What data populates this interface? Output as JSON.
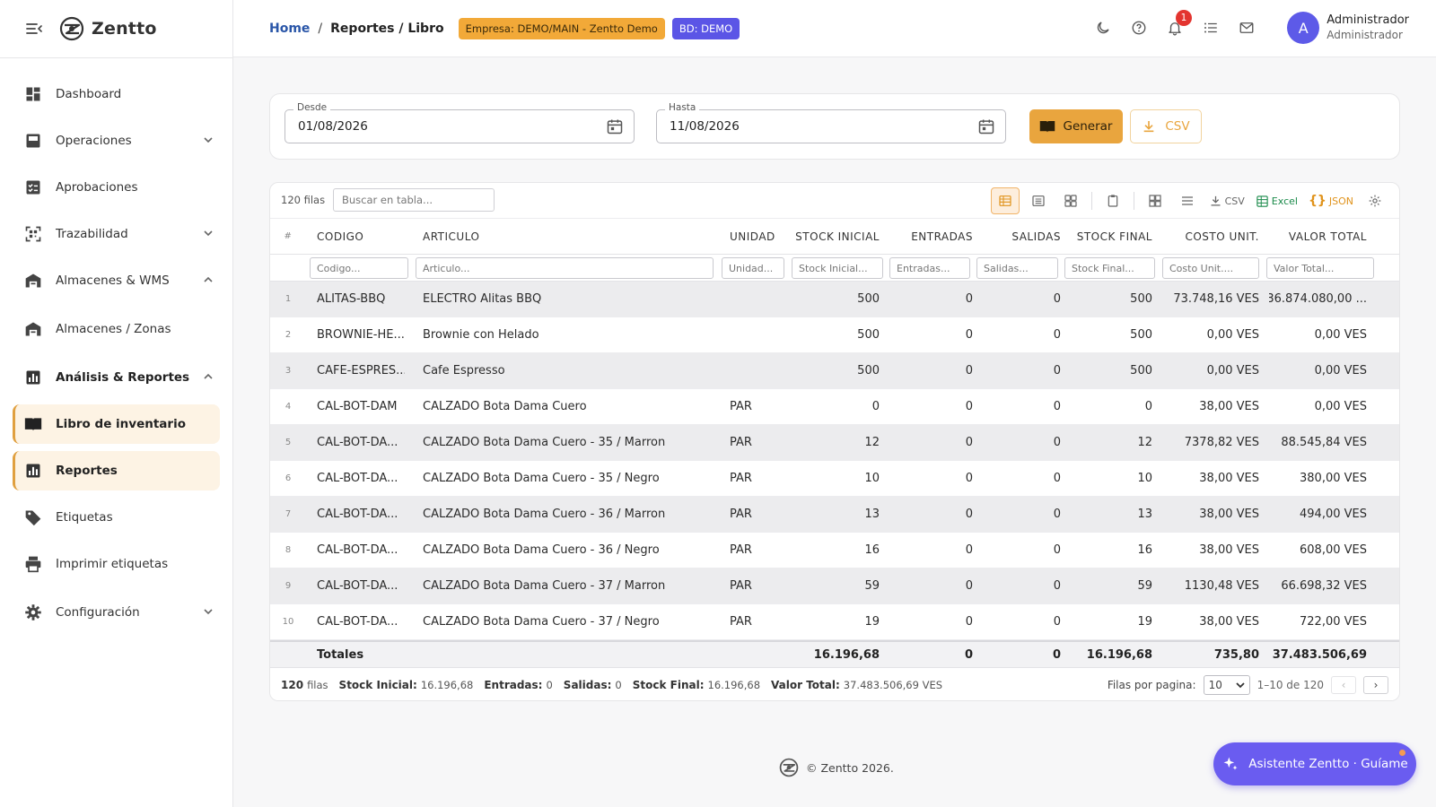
{
  "colors": {
    "accent": "#e9a53e",
    "brand_purple": "#5d5ae8",
    "link_blue": "#2a56a8",
    "badge_red": "#e3342f"
  },
  "brand": {
    "name": "Zentto"
  },
  "sidebar": {
    "items": [
      {
        "label": "Dashboard",
        "icon": "dashboard-icon"
      },
      {
        "label": "Operaciones",
        "icon": "inbox-icon",
        "chevron": "down"
      },
      {
        "label": "Aprobaciones",
        "icon": "checklist-icon"
      },
      {
        "label": "Trazabilidad",
        "icon": "qr-scan-icon",
        "chevron": "down"
      },
      {
        "label": "Almacenes & WMS",
        "icon": "warehouse-icon",
        "chevron": "up"
      },
      {
        "label": "Almacenes / Zonas",
        "icon": "warehouse-icon"
      },
      {
        "label": "Análisis & Reportes",
        "icon": "bar-chart-icon",
        "chevron": "up"
      },
      {
        "label": "Libro de inventario",
        "icon": "book-icon",
        "active": true
      },
      {
        "label": "Reportes",
        "icon": "bar-chart-icon",
        "active": true
      },
      {
        "label": "Etiquetas",
        "icon": "tag-icon"
      },
      {
        "label": "Imprimir etiquetas",
        "icon": "printer-icon"
      },
      {
        "label": "Configuración",
        "icon": "gear-icon",
        "chevron": "down"
      }
    ]
  },
  "header": {
    "breadcrumb": {
      "home": "Home",
      "separator": "/",
      "current": "Reportes / Libro"
    },
    "empresa_chip": "Empresa: DEMO/MAIN - Zentto Demo",
    "bd_chip": "BD: DEMO",
    "notifications_count": "1",
    "user": {
      "initial": "A",
      "name": "Administrador",
      "role": "Administrador"
    }
  },
  "filters": {
    "desde": {
      "label": "Desde",
      "value": "01/08/2026"
    },
    "hasta": {
      "label": "Hasta",
      "value": "11/08/2026"
    },
    "generar_label": "Generar",
    "csv_label": "CSV"
  },
  "grid": {
    "rows_count_label": "120 filas",
    "search_placeholder": "Buscar en tabla...",
    "toolbar": {
      "csv": "CSV",
      "excel": "Excel",
      "json": "JSON"
    },
    "columns": [
      "#",
      "CODIGO",
      "ARTICULO",
      "UNIDAD",
      "STOCK INICIAL",
      "ENTRADAS",
      "SALIDAS",
      "STOCK FINAL",
      "COSTO UNIT.",
      "VALOR TOTAL"
    ],
    "filter_placeholders": [
      "Codigo...",
      "Articulo...",
      "Unidad...",
      "Stock Inicial...",
      "Entradas...",
      "Salidas...",
      "Stock Final...",
      "Costo Unit....",
      "Valor Total..."
    ],
    "rows": [
      {
        "n": "1",
        "codigo": "ALITAS-BBQ",
        "articulo": "ELECTRO Alitas BBQ",
        "unidad": "",
        "stock_inicial": "500",
        "entradas": "0",
        "salidas": "0",
        "stock_final": "500",
        "costo_unit": "73.748,16 VES",
        "valor_total": "36.874.080,00 ..."
      },
      {
        "n": "2",
        "codigo": "BROWNIE-HE...",
        "articulo": "Brownie con Helado",
        "unidad": "",
        "stock_inicial": "500",
        "entradas": "0",
        "salidas": "0",
        "stock_final": "500",
        "costo_unit": "0,00 VES",
        "valor_total": "0,00 VES"
      },
      {
        "n": "3",
        "codigo": "CAFE-ESPRES...",
        "articulo": "Cafe Espresso",
        "unidad": "",
        "stock_inicial": "500",
        "entradas": "0",
        "salidas": "0",
        "stock_final": "500",
        "costo_unit": "0,00 VES",
        "valor_total": "0,00 VES"
      },
      {
        "n": "4",
        "codigo": "CAL-BOT-DAM",
        "articulo": "CALZADO Bota Dama Cuero",
        "unidad": "PAR",
        "stock_inicial": "0",
        "entradas": "0",
        "salidas": "0",
        "stock_final": "0",
        "costo_unit": "38,00 VES",
        "valor_total": "0,00 VES"
      },
      {
        "n": "5",
        "codigo": "CAL-BOT-DA...",
        "articulo": "CALZADO Bota Dama Cuero - 35 / Marron",
        "unidad": "PAR",
        "stock_inicial": "12",
        "entradas": "0",
        "salidas": "0",
        "stock_final": "12",
        "costo_unit": "7378,82 VES",
        "valor_total": "88.545,84 VES"
      },
      {
        "n": "6",
        "codigo": "CAL-BOT-DA...",
        "articulo": "CALZADO Bota Dama Cuero - 35 / Negro",
        "unidad": "PAR",
        "stock_inicial": "10",
        "entradas": "0",
        "salidas": "0",
        "stock_final": "10",
        "costo_unit": "38,00 VES",
        "valor_total": "380,00 VES"
      },
      {
        "n": "7",
        "codigo": "CAL-BOT-DA...",
        "articulo": "CALZADO Bota Dama Cuero - 36 / Marron",
        "unidad": "PAR",
        "stock_inicial": "13",
        "entradas": "0",
        "salidas": "0",
        "stock_final": "13",
        "costo_unit": "38,00 VES",
        "valor_total": "494,00 VES"
      },
      {
        "n": "8",
        "codigo": "CAL-BOT-DA...",
        "articulo": "CALZADO Bota Dama Cuero - 36 / Negro",
        "unidad": "PAR",
        "stock_inicial": "16",
        "entradas": "0",
        "salidas": "0",
        "stock_final": "16",
        "costo_unit": "38,00 VES",
        "valor_total": "608,00 VES"
      },
      {
        "n": "9",
        "codigo": "CAL-BOT-DA...",
        "articulo": "CALZADO Bota Dama Cuero - 37 / Marron",
        "unidad": "PAR",
        "stock_inicial": "59",
        "entradas": "0",
        "salidas": "0",
        "stock_final": "59",
        "costo_unit": "1130,48 VES",
        "valor_total": "66.698,32 VES"
      },
      {
        "n": "10",
        "codigo": "CAL-BOT-DA...",
        "articulo": "CALZADO Bota Dama Cuero - 37 / Negro",
        "unidad": "PAR",
        "stock_inicial": "19",
        "entradas": "0",
        "salidas": "0",
        "stock_final": "19",
        "costo_unit": "38,00 VES",
        "valor_total": "722,00 VES"
      }
    ],
    "totals": {
      "label": "Totales",
      "stock_inicial": "16.196,68",
      "entradas": "0",
      "salidas": "0",
      "stock_final": "16.196,68",
      "costo_unit": "735,80",
      "valor_total": "37.483.506,69"
    },
    "footer": {
      "count": "120",
      "count_suffix": "filas",
      "stock_inicial_label": "Stock Inicial:",
      "stock_inicial": "16.196,68",
      "entradas_label": "Entradas:",
      "entradas": "0",
      "salidas_label": "Salidas:",
      "salidas": "0",
      "stock_final_label": "Stock Final:",
      "stock_final": "16.196,68",
      "valor_total_label": "Valor Total:",
      "valor_total": "37.483.506,69 VES",
      "rows_per_page_label": "Filas por pagina:",
      "rows_per_page": "10",
      "range": "1–10 de 120"
    }
  },
  "page_footer": {
    "copyright": "© Zentto 2026."
  },
  "assistant": {
    "label": "Asistente Zentto · Guíame"
  }
}
